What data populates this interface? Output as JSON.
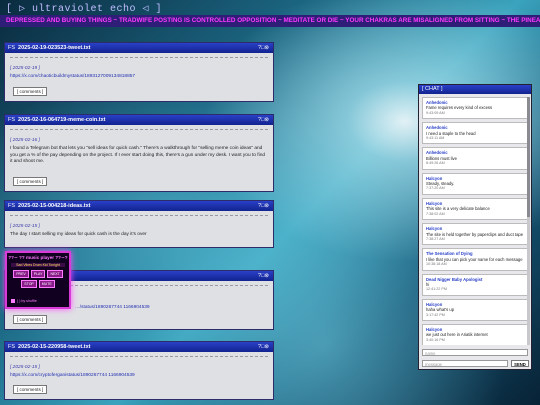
{
  "site_title": "[ ▷ ultraviolet echo ◁ ]",
  "marquee": "DEPRESSED AND BUYING THINGS ~ TRADWIFE POSTING IS CONTROLLED OPPOSITION ~ MEDITATE OR DIE ~ YOUR CHAKRAS ARE MISALIGNED FROM SITTING ~ THE PINEAL GLAND",
  "posts": [
    {
      "filename": "2025-02-19-023523-tweet.txt",
      "controls": "?□⊗",
      "date": "[ 2025-02-19 ]",
      "text": "",
      "link": "https://x.com/chaoticbuildmystatus/1893127009134818857",
      "button": "[ comments ]"
    },
    {
      "filename": "2025-02-16-064719-meme-coin.txt",
      "controls": "?□⊗",
      "date": "[ 2025-02-16 ]",
      "text": "I found a Telegram bot that lets you \"sell ideas for quick cash.\" There's a walkthrough for \"selling meme coin ideas\" and you get a % of the pay depending on the project. If I ever start doing this, there's a gun under my desk. I want you to find it and shoot me.",
      "link": "",
      "button": "[ comments ]"
    },
    {
      "filename": "2025-02-15-004218-ideas.txt",
      "controls": "?□⊗",
      "date": "[ 2025-02-15 ]",
      "text": "The day I start selling my ideas for quick cash is the day it's over",
      "link": "",
      "button": ""
    },
    {
      "filename": "",
      "controls": "?□⊗",
      "date": "",
      "text": "",
      "link": "…/status/1890267744 1166904539",
      "button": "[ comments ]"
    },
    {
      "filename": "2025-02-15-220958-tweet.txt",
      "controls": "?□⊗",
      "date": "[ 2025-02-15 ]",
      "text": "",
      "link": "https://x.com/cryptoferganistatus/1890267744 1166904539",
      "button": "[ comments ]"
    }
  ],
  "player": {
    "title": "??∽ ?? music player ??∽?",
    "track": "Sad Vibes Drum Kid Tonight",
    "buttons_row1": [
      "PREV",
      "PLAY",
      "NEXT"
    ],
    "buttons_row2": [
      "STOP",
      "MUTE"
    ],
    "shuffle": "( ) by shuffle"
  },
  "chat": {
    "header": "[ CHAT ]",
    "messages": [
      {
        "who": "Anhedonic",
        "text": "Fame requires every kind of excess",
        "when": "9:43:09 AM"
      },
      {
        "who": "Anhedonic",
        "text": "I need a staple to the head",
        "when": "9:43:11 AM"
      },
      {
        "who": "Anhedonic",
        "text": "Billions must live",
        "when": "8:49:26 AM"
      },
      {
        "who": "Halcyon",
        "text": "Steady, steady.",
        "when": "7:37:20 AM"
      },
      {
        "who": "Halcyon",
        "text": "This site is a very delicate balance",
        "when": "7:38:02 AM"
      },
      {
        "who": "Halcyon",
        "text": "The site is held together by paperclips and duct tape",
        "when": "7:38:27 AM"
      },
      {
        "who": "The Sensation of Dying",
        "text": "I like that you can pick your name for each message",
        "when": "10:38:18 AM"
      },
      {
        "who": "Dead Nigger Baby Apologist",
        "text": "hi",
        "when": "12:41:22 PM"
      },
      {
        "who": "Halcyon",
        "text": "haha what's up",
        "when": "3:17:42 PM"
      },
      {
        "who": "Halcyon",
        "text": "we just out here in Ariatik internet",
        "when": "3:40:16 PM"
      }
    ],
    "name_placeholder": "name",
    "message_placeholder": "message",
    "send_label": "SEND"
  }
}
